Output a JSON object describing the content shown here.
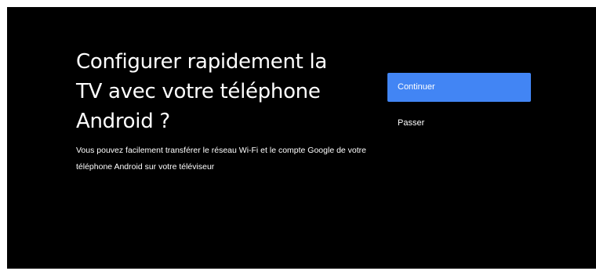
{
  "setup": {
    "title": "Configurer rapidement la TV avec votre téléphone Android ?",
    "description": "Vous pouvez facilement transférer le réseau Wi-Fi et le compte Google de votre téléphone Android sur votre téléviseur"
  },
  "actions": {
    "continue_label": "Continuer",
    "skip_label": "Passer"
  },
  "colors": {
    "background": "#000000",
    "accent": "#4285f4",
    "text": "#ffffff"
  }
}
